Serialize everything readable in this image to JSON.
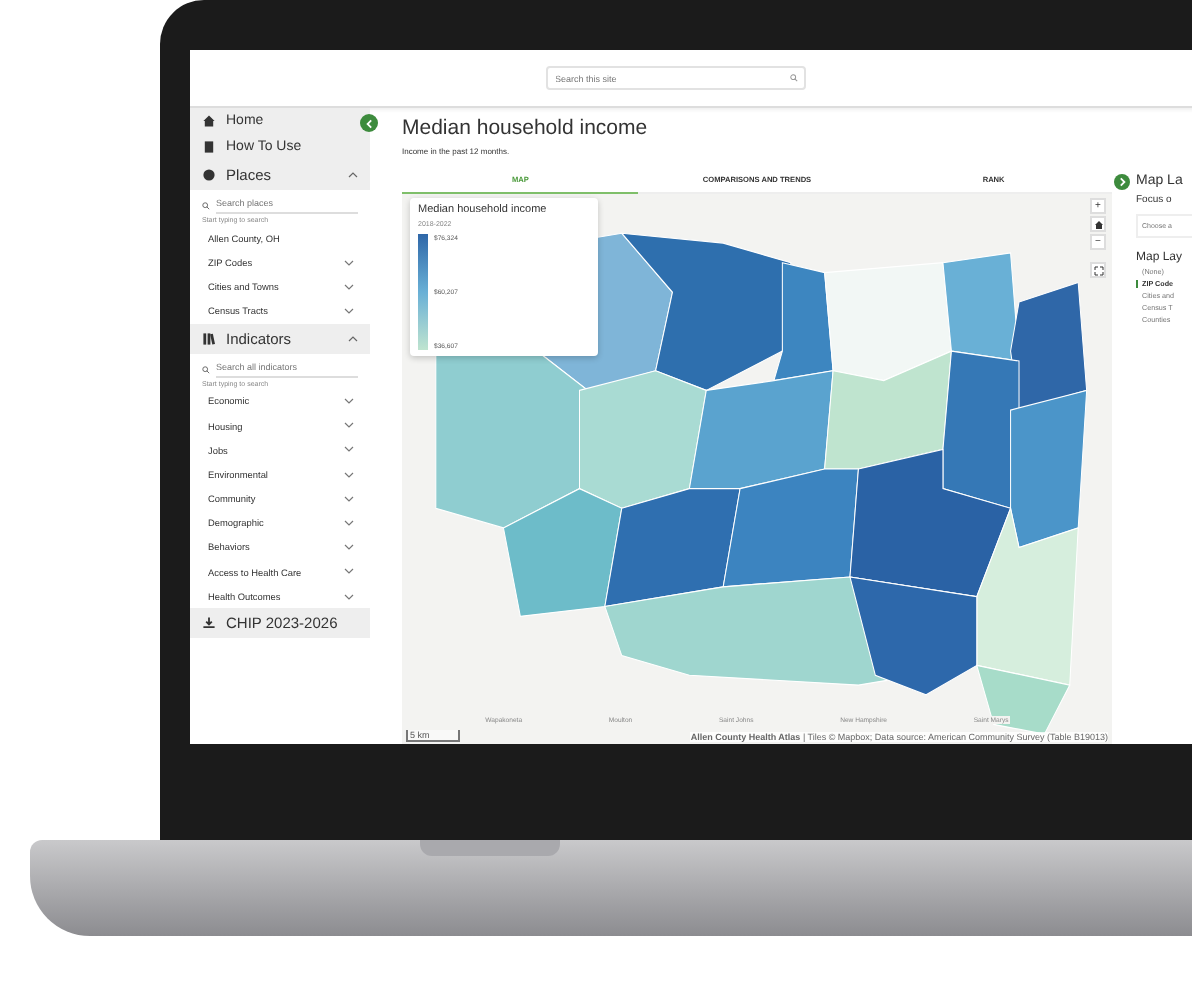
{
  "header": {
    "search": {
      "placeholder": "Search this site"
    }
  },
  "sidebar": {
    "top_items": [
      {
        "label": "Home"
      },
      {
        "label": "How To Use"
      }
    ],
    "sections": [
      {
        "title": "Places",
        "expanded": true,
        "search_placeholder": "Search places",
        "hint": "Start typing to search",
        "items": [
          {
            "label": "Allen County, OH"
          },
          {
            "label": "ZIP Codes",
            "expanded": false
          },
          {
            "label": "Cities and Towns",
            "expanded": false
          },
          {
            "label": "Census Tracts",
            "expanded": false
          }
        ]
      },
      {
        "title": "Indicators",
        "expanded": true,
        "search_placeholder": "Search all indicators",
        "hint": "Start typing to search",
        "items": [
          {
            "label": "Economic",
            "expanded": false
          },
          {
            "label": "Housing",
            "expanded": false
          },
          {
            "label": "Jobs",
            "expanded": false
          },
          {
            "label": "Environmental",
            "expanded": false
          },
          {
            "label": "Community",
            "expanded": false
          },
          {
            "label": "Demographic",
            "expanded": false
          },
          {
            "label": "Behaviors",
            "expanded": false
          },
          {
            "label": "Access to Health Care",
            "expanded": false
          },
          {
            "label": "Health Outcomes",
            "expanded": false
          }
        ]
      }
    ],
    "bottom_item": {
      "label": "CHIP 2023-2026"
    }
  },
  "page": {
    "title": "Median household income",
    "subtitle": "Income in the past 12 months."
  },
  "tabs": [
    {
      "label": "MAP",
      "selected": true
    },
    {
      "label": "COMPARISONS AND TRENDS",
      "selected": false
    },
    {
      "label": "RANK",
      "selected": false
    }
  ],
  "legend": {
    "title": "Median household income",
    "period": "2018-2022",
    "values": [
      "$76,324",
      "$60,207",
      "$36,607"
    ]
  },
  "map": {
    "places": [
      "Wapakoneta",
      "Moulton",
      "Saint Johns",
      "New Hampshire",
      "Saint Marys"
    ],
    "scale": "5 km",
    "attribution_bold": "Allen County Health Atlas",
    "attribution": "| Tiles © Mapbox; Data source: American Community Survey (Table B19013)",
    "controls": [
      "+",
      "−"
    ]
  },
  "layers_panel": {
    "title": "Map La",
    "focus_label": "Focus o",
    "focus_placeholder": "Choose a",
    "layers_title": "Map Lay",
    "layers": [
      {
        "label": "(None)",
        "selected": false
      },
      {
        "label": "ZIP Code",
        "selected": true
      },
      {
        "label": "Cities and",
        "selected": false
      },
      {
        "label": "Census T",
        "selected": false
      },
      {
        "label": "Counties",
        "selected": false
      }
    ]
  }
}
